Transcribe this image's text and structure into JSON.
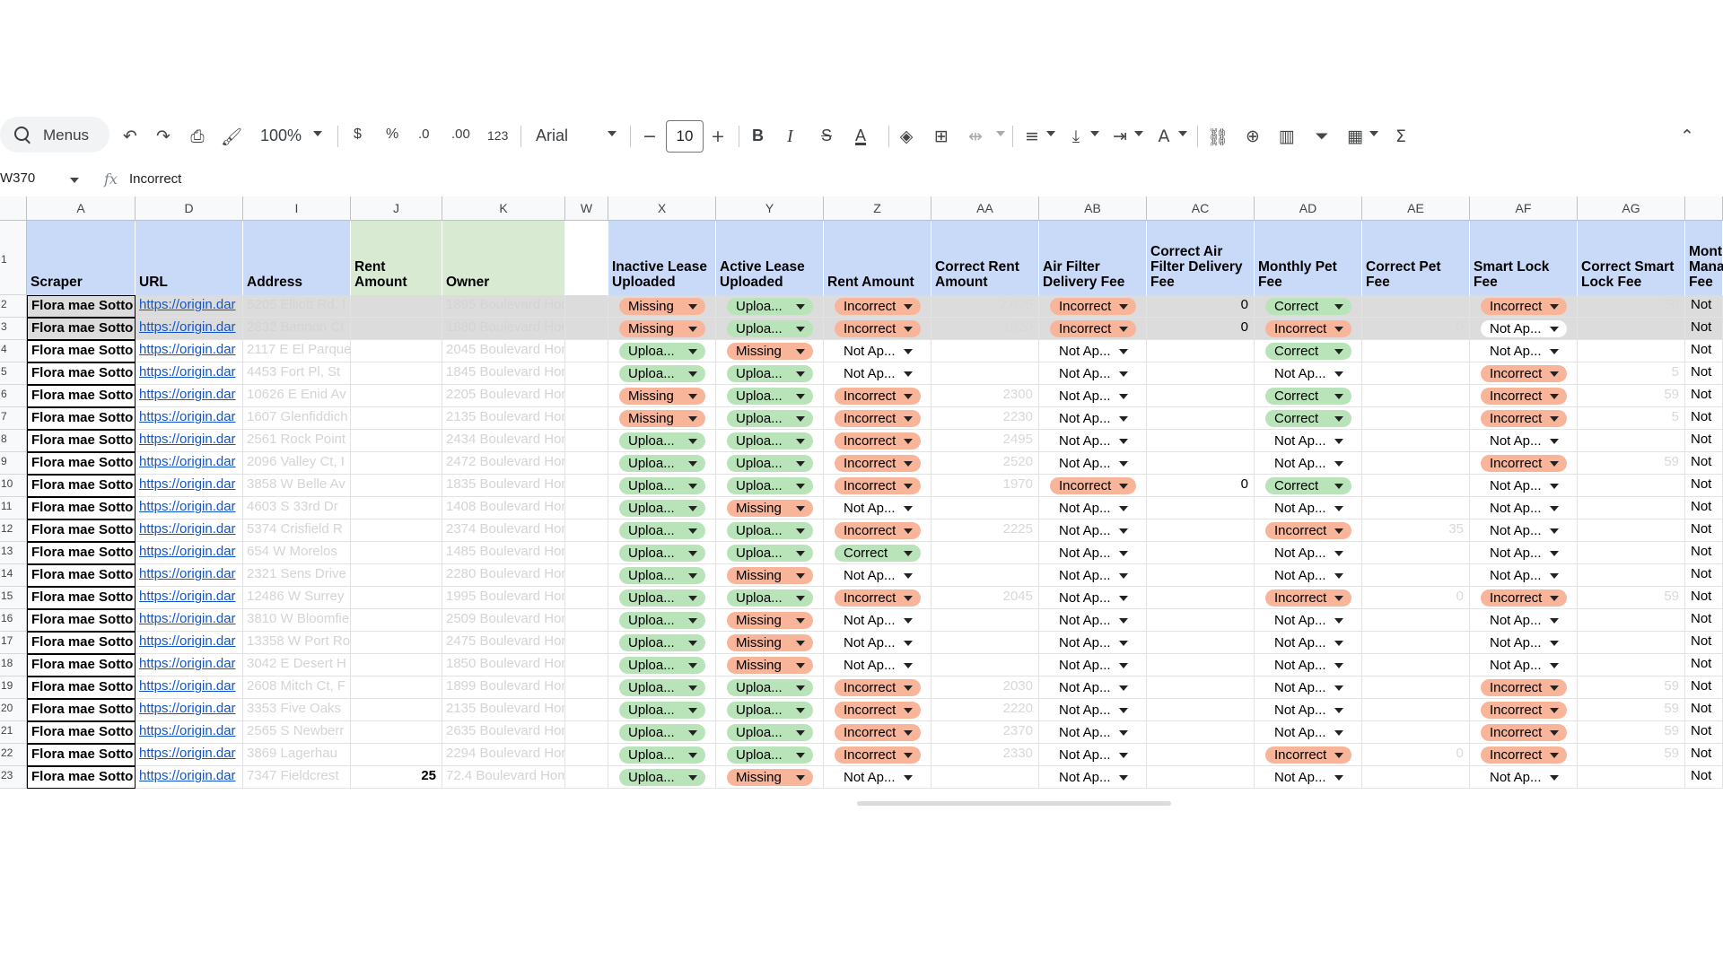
{
  "toolbar": {
    "menus_label": "Menus",
    "zoom": "100%",
    "currency": "$",
    "percent": "%",
    "dec_decrease": ".0",
    "dec_increase": ".00",
    "number_format": "123",
    "font": "Arial",
    "font_size": "10",
    "bold": "B",
    "italic": "I",
    "strike": "S",
    "text_color": "A"
  },
  "formula_bar": {
    "cell_ref": "W370",
    "fx": "fx",
    "value": "Incorrect"
  },
  "columns": [
    "A",
    "D",
    "I",
    "J",
    "K",
    "W",
    "X",
    "Y",
    "Z",
    "AA",
    "AB",
    "AC",
    "AD",
    "AE",
    "AF",
    "AG"
  ],
  "headers": {
    "scraper": "Scraper",
    "url": "URL",
    "address": "Address",
    "rent_amount_j": "Rent Amount",
    "owner": "Owner",
    "inactive_lease": "Inactive Lease Uploaded",
    "active_lease": "Active Lease Uploaded",
    "rent_amount": "Rent Amount",
    "correct_rent": "Correct Rent Amount",
    "air_filter": "Air Filter Delivery Fee",
    "correct_air_filter": "Correct Air Filter Delivery Fee",
    "monthly_pet": "Monthly Pet Fee",
    "correct_pet": "Correct Pet Fee",
    "smart_lock": "Smart Lock Fee",
    "correct_smart_lock": "Correct Smart Lock Fee",
    "monthly_mgmt": "Mont Mana Fee"
  },
  "rows": [
    {
      "n": "2",
      "scraper": "Flora mae Sotto",
      "url": "https://origin.dar",
      "address": "5205 Elliott Rd, I",
      "rent": "",
      "owner": "1895  Boulevard Homes",
      "x": "Missing",
      "y": "Uploa...",
      "z": "Incorrect",
      "aa": "2,025",
      "ab": "Incorrect",
      "ac": "0",
      "ad": "Correct",
      "ae": "",
      "af": "Incorrect",
      "ag": "59",
      "last": "Not"
    },
    {
      "n": "3",
      "scraper": "Flora mae Sotto",
      "url": "https://origin.dar",
      "address": "2832 Bannon Ct",
      "rent": "",
      "owner": "1880  Boulevard Homes",
      "x": "Missing",
      "y": "Uploa...",
      "z": "Incorrect",
      "aa": "1920",
      "ab": "Incorrect",
      "ac": "0",
      "ad": "Incorrect",
      "ae": "0",
      "af": "Not Ap...",
      "ag": "",
      "last": "Not"
    },
    {
      "n": "4",
      "scraper": "Flora mae Sotto",
      "url": "https://origin.dar",
      "address": "2117 E El Parque",
      "rent": "",
      "owner": "2045  Boulevard Homes",
      "x": "Uploa...",
      "y": "Missing",
      "z": "Not Ap...",
      "aa": "",
      "ab": "Not Ap...",
      "ac": "",
      "ad": "Correct",
      "ae": "",
      "af": "Not Ap...",
      "ag": "",
      "last": "Not"
    },
    {
      "n": "5",
      "scraper": "Flora mae Sotto",
      "url": "https://origin.dar",
      "address": "4453 Fort Pl, St",
      "rent": "",
      "owner": "1845  Boulevard Homes",
      "x": "Uploa...",
      "y": "Uploa...",
      "z": "Not Ap...",
      "aa": "",
      "ab": "Not Ap...",
      "ac": "",
      "ad": "Not Ap...",
      "ae": "",
      "af": "Incorrect",
      "ag": "5",
      "last": "Not"
    },
    {
      "n": "6",
      "scraper": "Flora mae Sotto",
      "url": "https://origin.dar",
      "address": "10626 E Enid Av",
      "rent": "",
      "owner": "2205  Boulevard Homes",
      "x": "Missing",
      "y": "Uploa...",
      "z": "Incorrect",
      "aa": "2300",
      "ab": "Not Ap...",
      "ac": "",
      "ad": "Correct",
      "ae": "",
      "af": "Incorrect",
      "ag": "59",
      "last": "Not"
    },
    {
      "n": "7",
      "scraper": "Flora mae Sotto",
      "url": "https://origin.dar",
      "address": "1607 Glenfiddich",
      "rent": "",
      "owner": "2135  Boulevard Homes",
      "x": "Missing",
      "y": "Uploa...",
      "z": "Incorrect",
      "aa": "2230",
      "ab": "Not Ap...",
      "ac": "",
      "ad": "Correct",
      "ae": "",
      "af": "Incorrect",
      "ag": "5",
      "last": "Not"
    },
    {
      "n": "8",
      "scraper": "Flora mae Sotto",
      "url": "https://origin.dar",
      "address": "2561 Rock Point",
      "rent": "",
      "owner": "2434  Boulevard Homes",
      "x": "Uploa...",
      "y": "Uploa...",
      "z": "Incorrect",
      "aa": "2495",
      "ab": "Not Ap...",
      "ac": "",
      "ad": "Not Ap...",
      "ae": "",
      "af": "Not Ap...",
      "ag": "",
      "last": "Not"
    },
    {
      "n": "9",
      "scraper": "Flora mae Sotto",
      "url": "https://origin.dar",
      "address": "2096 Valley Ct, I",
      "rent": "",
      "owner": "2472  Boulevard Homes",
      "x": "Uploa...",
      "y": "Uploa...",
      "z": "Incorrect",
      "aa": "2520",
      "ab": "Not Ap...",
      "ac": "",
      "ad": "Not Ap...",
      "ae": "",
      "af": "Incorrect",
      "ag": "59",
      "last": "Not"
    },
    {
      "n": "10",
      "scraper": "Flora mae Sotto",
      "url": "https://origin.dar",
      "address": "3858 W Belle Av",
      "rent": "",
      "owner": "1835  Boulevard Homes",
      "x": "Uploa...",
      "y": "Uploa...",
      "z": "Incorrect",
      "aa": "1970",
      "ab": "Incorrect",
      "ac": "0",
      "ad": "Correct",
      "ae": "",
      "af": "Not Ap...",
      "ag": "",
      "last": "Not"
    },
    {
      "n": "11",
      "scraper": "Flora mae Sotto",
      "url": "https://origin.dar",
      "address": "4603 S 33rd Dr",
      "rent": "",
      "owner": "1408  Boulevard Homes",
      "x": "Uploa...",
      "y": "Missing",
      "z": "Not Ap...",
      "aa": "",
      "ab": "Not Ap...",
      "ac": "",
      "ad": "Not Ap...",
      "ae": "",
      "af": "Not Ap...",
      "ag": "",
      "last": "Not"
    },
    {
      "n": "12",
      "scraper": "Flora mae Sotto",
      "url": "https://origin.dar",
      "address": "5374 Crisfield R",
      "rent": "",
      "owner": "2374  Boulevard Homes",
      "x": "Uploa...",
      "y": "Uploa...",
      "z": "Incorrect",
      "aa": "2225",
      "ab": "Not Ap...",
      "ac": "",
      "ad": "Incorrect",
      "ae": "35",
      "af": "Not Ap...",
      "ag": "",
      "last": "Not"
    },
    {
      "n": "13",
      "scraper": "Flora mae Sotto",
      "url": "https://origin.dar",
      "address": "654 W Morelos",
      "rent": "",
      "owner": "1485  Boulevard Homes",
      "x": "Uploa...",
      "y": "Uploa...",
      "z": "Correct",
      "aa": "",
      "ab": "Not Ap...",
      "ac": "",
      "ad": "Not Ap...",
      "ae": "",
      "af": "Not Ap...",
      "ag": "",
      "last": "Not"
    },
    {
      "n": "14",
      "scraper": "Flora mae Sotto",
      "url": "https://origin.dar",
      "address": "2321 Sens Drive",
      "rent": "",
      "owner": "2280  Boulevard Homes",
      "x": "Uploa...",
      "y": "Missing",
      "z": "Not Ap...",
      "aa": "",
      "ab": "Not Ap...",
      "ac": "",
      "ad": "Not Ap...",
      "ae": "",
      "af": "Not Ap...",
      "ag": "",
      "last": "Not"
    },
    {
      "n": "15",
      "scraper": "Flora mae Sotto",
      "url": "https://origin.dar",
      "address": "12486 W Surrey",
      "rent": "",
      "owner": "1995  Boulevard Homes",
      "x": "Uploa...",
      "y": "Uploa...",
      "z": "Incorrect",
      "aa": "2045",
      "ab": "Not Ap...",
      "ac": "",
      "ad": "Incorrect",
      "ae": "0",
      "af": "Incorrect",
      "ag": "59",
      "last": "Not"
    },
    {
      "n": "16",
      "scraper": "Flora mae Sotto",
      "url": "https://origin.dar",
      "address": "3810 W Bloomfie",
      "rent": "",
      "owner": "2509  Boulevard Homes",
      "x": "Uploa...",
      "y": "Missing",
      "z": "Not Ap...",
      "aa": "",
      "ab": "Not Ap...",
      "ac": "",
      "ad": "Not Ap...",
      "ae": "",
      "af": "Not Ap...",
      "ag": "",
      "last": "Not"
    },
    {
      "n": "17",
      "scraper": "Flora mae Sotto",
      "url": "https://origin.dar",
      "address": "13358 W Port Ro",
      "rent": "",
      "owner": "2475  Boulevard Homes",
      "x": "Uploa...",
      "y": "Missing",
      "z": "Not Ap...",
      "aa": "",
      "ab": "Not Ap...",
      "ac": "",
      "ad": "Not Ap...",
      "ae": "",
      "af": "Not Ap...",
      "ag": "",
      "last": "Not"
    },
    {
      "n": "18",
      "scraper": "Flora mae Sotto",
      "url": "https://origin.dar",
      "address": "3042 E Desert H",
      "rent": "",
      "owner": "1850  Boulevard Homes",
      "x": "Uploa...",
      "y": "Missing",
      "z": "Not Ap...",
      "aa": "",
      "ab": "Not Ap...",
      "ac": "",
      "ad": "Not Ap...",
      "ae": "",
      "af": "Not Ap...",
      "ag": "",
      "last": "Not"
    },
    {
      "n": "19",
      "scraper": "Flora mae Sotto",
      "url": "https://origin.dar",
      "address": "2608 Mitch Ct, F",
      "rent": "",
      "owner": "1899  Boulevard Homes",
      "x": "Uploa...",
      "y": "Uploa...",
      "z": "Incorrect",
      "aa": "2030",
      "ab": "Not Ap...",
      "ac": "",
      "ad": "Not Ap...",
      "ae": "",
      "af": "Incorrect",
      "ag": "59",
      "last": "Not"
    },
    {
      "n": "20",
      "scraper": "Flora mae Sotto",
      "url": "https://origin.dar",
      "address": "3353 Five Oaks",
      "rent": "",
      "owner": "2135  Boulevard Homes",
      "x": "Uploa...",
      "y": "Uploa...",
      "z": "Incorrect",
      "aa": "2220",
      "ab": "Not Ap...",
      "ac": "",
      "ad": "Not Ap...",
      "ae": "",
      "af": "Incorrect",
      "ag": "59",
      "last": "Not"
    },
    {
      "n": "21",
      "scraper": "Flora mae Sotto",
      "url": "https://origin.dar",
      "address": "2565 S Newberr",
      "rent": "",
      "owner": "2635  Boulevard Homes",
      "x": "Uploa...",
      "y": "Uploa...",
      "z": "Incorrect",
      "aa": "2370",
      "ab": "Not Ap...",
      "ac": "",
      "ad": "Not Ap...",
      "ae": "",
      "af": "Incorrect",
      "ag": "59",
      "last": "Not"
    },
    {
      "n": "22",
      "scraper": "Flora mae Sotto",
      "url": "https://origin.dar",
      "address": "3869 Lagerhau",
      "rent": "",
      "owner": "2294  Boulevard Homes",
      "x": "Uploa...",
      "y": "Uploa...",
      "z": "Incorrect",
      "aa": "2330",
      "ab": "Not Ap...",
      "ac": "",
      "ad": "Incorrect",
      "ae": "0",
      "af": "Incorrect",
      "ag": "59",
      "last": "Not"
    },
    {
      "n": "23",
      "scraper": "Flora mae Sotto",
      "url": "https://origin.dar",
      "address": "7347 Fieldcrest",
      "rent": "25",
      "owner": "72.4  Boulevard Homes",
      "x": "Uploa...",
      "y": "Missing",
      "z": "Not Ap...",
      "aa": "",
      "ab": "Not Ap...",
      "ac": "",
      "ad": "Not Ap...",
      "ae": "",
      "af": "Not Ap...",
      "ag": "",
      "last": "Not"
    }
  ],
  "colors": {
    "chip_red": "#f8b59a",
    "chip_green": "#b9e3b8",
    "header_blue": "#c9daf8",
    "header_green": "#d9ead3"
  },
  "icons": [
    "search-icon",
    "undo-icon",
    "redo-icon",
    "print-icon",
    "paint-format-icon",
    "bold-icon",
    "italic-icon",
    "strikethrough-icon",
    "text-color-icon",
    "fill-color-icon",
    "borders-icon",
    "merge-icon",
    "align-icon",
    "valign-icon",
    "wrap-icon",
    "rotate-icon",
    "link-icon",
    "comment-icon",
    "chart-icon",
    "filter-icon",
    "table-icon",
    "sum-icon",
    "collapse-icon"
  ]
}
